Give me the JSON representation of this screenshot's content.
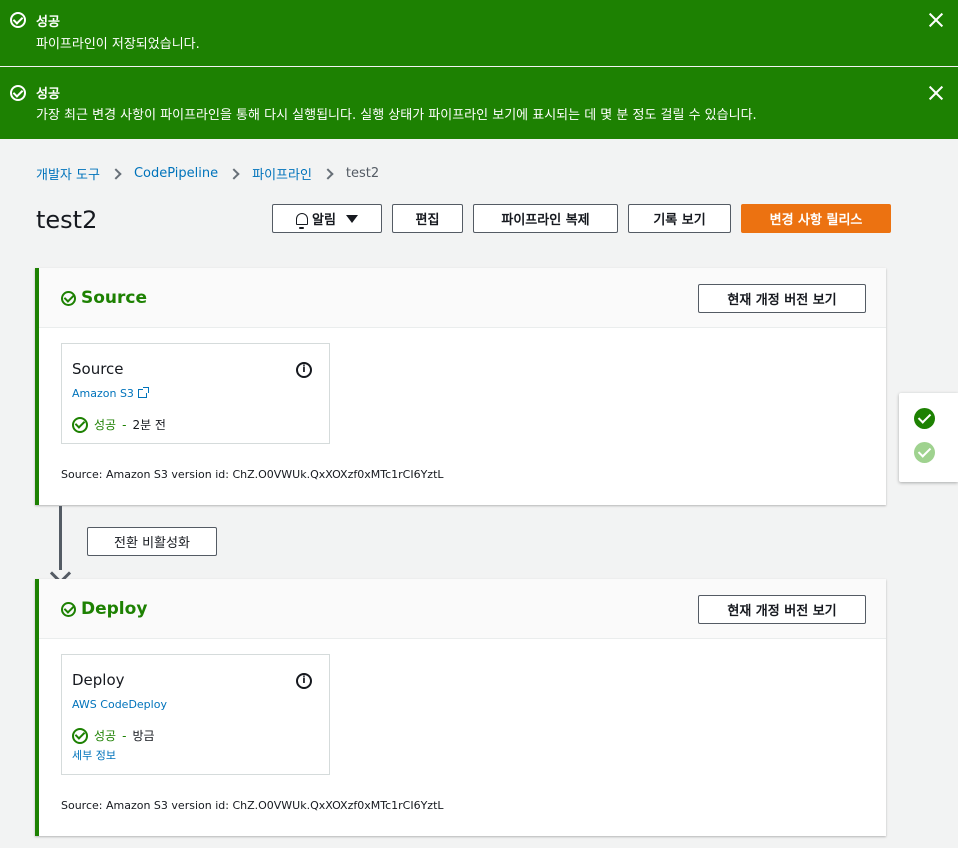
{
  "flash": [
    {
      "title": "성공",
      "message": "파이프라인이 저장되었습니다."
    },
    {
      "title": "성공",
      "message": "가장 최근 변경 사항이 파이프라인을 통해 다시 실행됩니다. 실행 상태가 파이프라인 보기에 표시되는 데 몇 분 정도 걸릴 수 있습니다."
    }
  ],
  "breadcrumb": [
    "개발자 도구",
    "CodePipeline",
    "파이프라인",
    "test2"
  ],
  "page_title": "test2",
  "toolbar": {
    "notify": "알림",
    "edit": "편집",
    "clone": "파이프라인 복제",
    "history": "기록 보기",
    "release": "변경 사항 릴리스"
  },
  "stages": [
    {
      "name": "Source",
      "view_revision": "현재 개정 버전 보기",
      "action": {
        "name": "Source",
        "provider": "Amazon S3",
        "status": "성공",
        "time": "2분 전"
      },
      "revision": "Source: Amazon S3 version id: ChZ.O0VWUk.QxXOXzf0xMTc1rCI6YztL"
    },
    {
      "name": "Deploy",
      "view_revision": "현재 개정 버전 보기",
      "action": {
        "name": "Deploy",
        "provider": "AWS CodeDeploy",
        "status": "성공",
        "time": "방금",
        "details": "세부 정보"
      },
      "revision": "Source: Amazon S3 version id: ChZ.O0VWUk.QxXOXzf0xMTc1rCI6YztL"
    }
  ],
  "transition": {
    "button": "전환 비활성화"
  },
  "colors": {
    "success": "#1d8102",
    "primary": "#ec7211",
    "link": "#0073bb"
  }
}
